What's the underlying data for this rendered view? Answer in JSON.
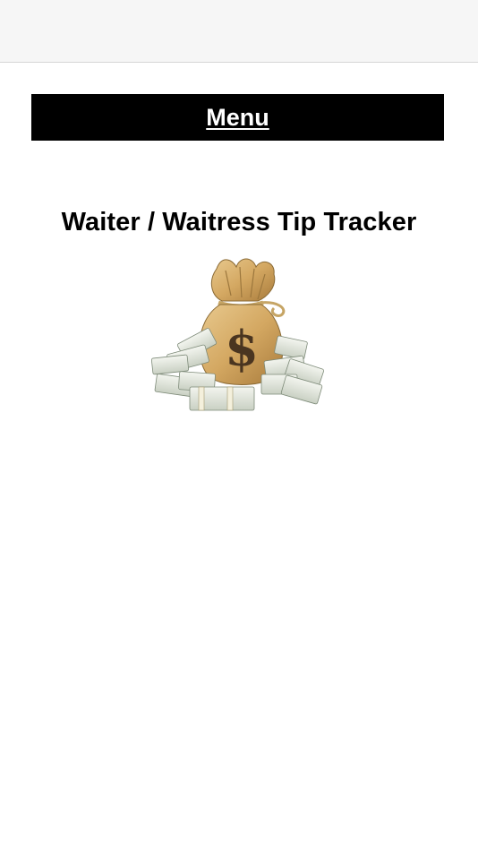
{
  "browser": {
    "top_bar_color": "#f6f6f6"
  },
  "menu": {
    "label": "Menu",
    "background": "#000000",
    "text_color": "#ffffff"
  },
  "page": {
    "title": "Waiter / Waitress Tip Tracker"
  },
  "illustration": {
    "icon": "money-bag-with-cash-stacks-icon",
    "bag_symbol": "$"
  }
}
